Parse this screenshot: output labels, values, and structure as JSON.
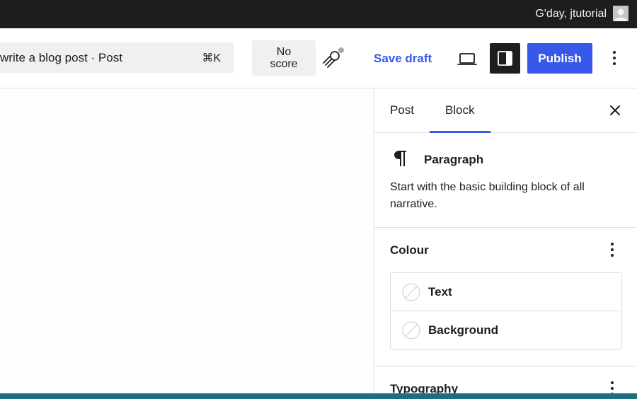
{
  "admin_bar": {
    "greeting": "G'day, jtutorial"
  },
  "header": {
    "command_bar_title": "write a blog post · Post",
    "command_shortcut": "⌘K",
    "score_line1": "No",
    "score_line2": "score",
    "save_draft_label": "Save draft",
    "publish_label": "Publish",
    "icons": [
      "rocket-icon",
      "desktop-preview-icon",
      "sidebar-toggle-icon",
      "more-vertical-icon"
    ]
  },
  "sidebar": {
    "tabs": [
      {
        "label": "Post",
        "active": false
      },
      {
        "label": "Block",
        "active": true
      }
    ],
    "block": {
      "icon": "paragraph-icon",
      "name": "Paragraph",
      "description": "Start with the basic building block of all narrative."
    },
    "colour_panel": {
      "title": "Colour",
      "items": [
        {
          "label": "Text",
          "icon": "empty-swatch-icon"
        },
        {
          "label": "Background",
          "icon": "empty-swatch-icon"
        }
      ]
    },
    "typography_panel": {
      "title": "Typography"
    }
  },
  "colors": {
    "accent": "#3858e9",
    "admin_bar": "#1d1d1d",
    "bottom_bar": "#1b6f80"
  }
}
